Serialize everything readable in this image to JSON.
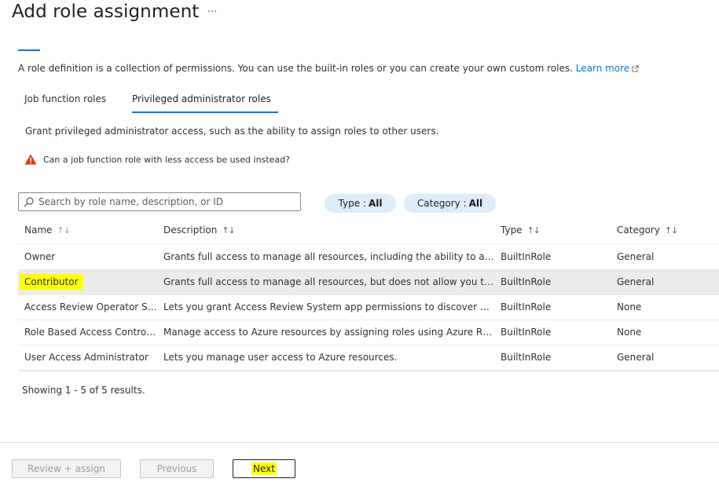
{
  "header": {
    "title": "Add role assignment",
    "more": "···"
  },
  "intro": {
    "text": "A role definition is a collection of permissions. You can use the built-in roles or you can create your own custom roles.",
    "learn_more": "Learn more"
  },
  "tabs": [
    {
      "label": "Job function roles",
      "selected": false
    },
    {
      "label": "Privileged administrator roles",
      "selected": true
    }
  ],
  "description": "Grant privileged administrator access, such as the ability to assign roles to other users.",
  "warning": "Can a job function role with less access be used instead?",
  "search": {
    "placeholder": "Search by role name, description, or ID",
    "value": ""
  },
  "filters": [
    {
      "label": "Type :",
      "value": "All"
    },
    {
      "label": "Category :",
      "value": "All"
    }
  ],
  "grid": {
    "columns": [
      "Name",
      "Description",
      "Type",
      "Category"
    ],
    "rows": [
      {
        "name": "Owner",
        "description": "Grants full access to manage all resources, including the ability to assign roles in Azure RBAC.",
        "type": "BuiltInRole",
        "category": "General",
        "selected": false
      },
      {
        "name": "Contributor",
        "description": "Grants full access to manage all resources, but does not allow you to assign roles in Azure RBAC.",
        "type": "BuiltInRole",
        "category": "General",
        "selected": true
      },
      {
        "name": "Access Review Operator Service Role",
        "description": "Lets you grant Access Review System app permissions to discover and revoke access.",
        "type": "BuiltInRole",
        "category": "None",
        "selected": false
      },
      {
        "name": "Role Based Access Control Administrator",
        "description": "Manage access to Azure resources by assigning roles using Azure RBAC.",
        "type": "BuiltInRole",
        "category": "None",
        "selected": false
      },
      {
        "name": "User Access Administrator",
        "description": "Lets you manage user access to Azure resources.",
        "type": "BuiltInRole",
        "category": "General",
        "selected": false
      }
    ],
    "status": "Showing 1 - 5 of 5 results."
  },
  "footer": {
    "review_assign": "Review + assign",
    "previous": "Previous",
    "next": "Next"
  },
  "colors": {
    "accent": "#0078d4",
    "highlight": "#ffff00",
    "warning": "#d83b01",
    "pill": "#deecf9"
  }
}
